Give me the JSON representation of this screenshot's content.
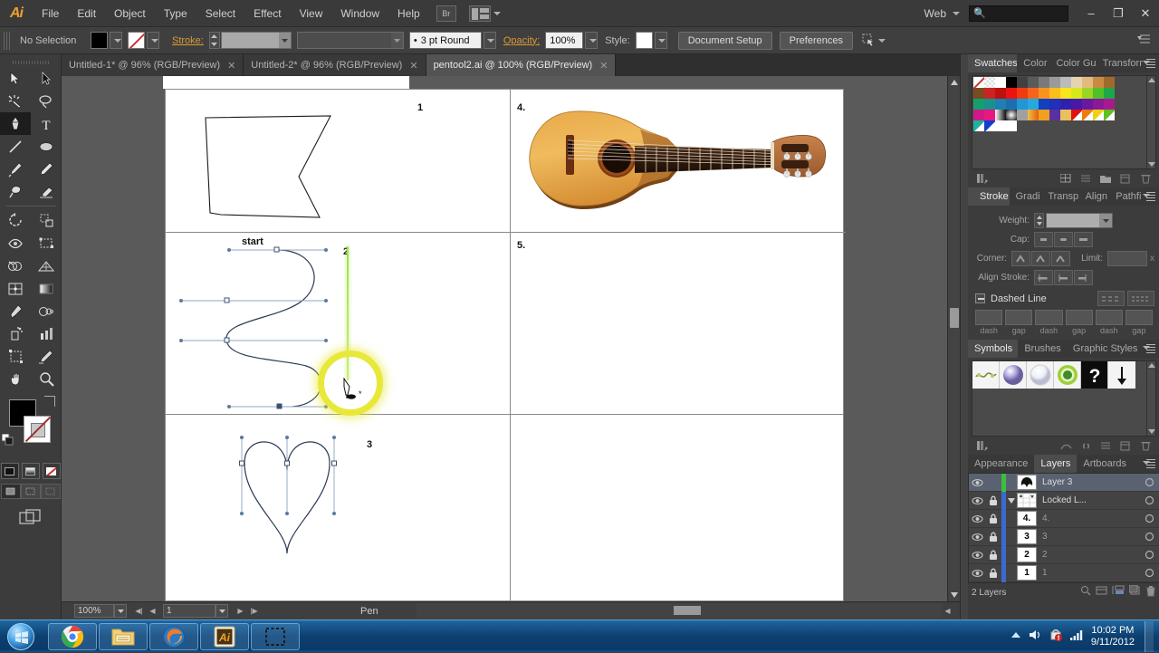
{
  "app": {
    "name": "Adobe Illustrator",
    "logo_text": "Ai"
  },
  "menubar": {
    "items": [
      "File",
      "Edit",
      "Object",
      "Type",
      "Select",
      "Effect",
      "View",
      "Window",
      "Help"
    ],
    "bridge_icon": "bridge-icon",
    "arrange_icon": "arrange-documents-icon",
    "workspace_label": "Web",
    "search_placeholder": "",
    "window_controls": {
      "minimize": "–",
      "restore": "❐",
      "close": "✕"
    }
  },
  "controlbar": {
    "selection_status": "No Selection",
    "fill_color": "#000000",
    "stroke_label": "Stroke:",
    "stroke_weight_value": "",
    "stroke_profile_value": "",
    "brush_value": "3 pt Round",
    "opacity_label": "Opacity:",
    "opacity_value": "100%",
    "style_label": "Style:",
    "document_setup_label": "Document Setup",
    "preferences_label": "Preferences",
    "transform_icon": "transform-icon",
    "panel_menu_icon": "panel-options-icon"
  },
  "tabs": [
    {
      "title": "Untitled-1* @ 96% (RGB/Preview)",
      "active": false,
      "close": "✕"
    },
    {
      "title": "Untitled-2* @ 96% (RGB/Preview)",
      "active": false,
      "close": "✕"
    },
    {
      "title": "pentool2.ai @ 100% (RGB/Preview)",
      "active": true,
      "close": "✕"
    }
  ],
  "toolbar": {
    "tools": [
      {
        "name": "selection-tool",
        "selected": false
      },
      {
        "name": "direct-selection-tool",
        "selected": false
      },
      {
        "name": "magic-wand-tool",
        "selected": false
      },
      {
        "name": "lasso-tool",
        "selected": false
      },
      {
        "name": "pen-tool",
        "selected": true
      },
      {
        "name": "type-tool",
        "selected": false
      },
      {
        "name": "line-segment-tool",
        "selected": false
      },
      {
        "name": "ellipse-tool",
        "selected": false
      },
      {
        "name": "paintbrush-tool",
        "selected": false
      },
      {
        "name": "pencil-tool",
        "selected": false
      },
      {
        "name": "blob-brush-tool",
        "selected": false
      },
      {
        "name": "eraser-tool",
        "selected": false
      },
      {
        "name": "rotate-tool",
        "selected": false
      },
      {
        "name": "scale-tool",
        "selected": false
      },
      {
        "name": "width-tool",
        "selected": false
      },
      {
        "name": "free-transform-tool",
        "selected": false
      },
      {
        "name": "shape-builder-tool",
        "selected": false
      },
      {
        "name": "perspective-grid-tool",
        "selected": false
      },
      {
        "name": "mesh-tool",
        "selected": false
      },
      {
        "name": "gradient-tool",
        "selected": false
      },
      {
        "name": "eyedropper-tool",
        "selected": false
      },
      {
        "name": "blend-tool",
        "selected": false
      },
      {
        "name": "symbol-sprayer-tool",
        "selected": false
      },
      {
        "name": "column-graph-tool",
        "selected": false
      },
      {
        "name": "artboard-tool",
        "selected": false
      },
      {
        "name": "slice-tool",
        "selected": false
      },
      {
        "name": "hand-tool",
        "selected": false
      },
      {
        "name": "zoom-tool",
        "selected": false
      }
    ],
    "fill_color": "#000000",
    "stroke_color": "#ffffff",
    "draw_modes": [
      "draw-normal",
      "draw-behind",
      "draw-inside"
    ],
    "screen_mode": "screen-mode-icon"
  },
  "canvas": {
    "panels": [
      {
        "number": "1",
        "content": "polygon-shape"
      },
      {
        "number": "2",
        "content": "s-curve-path",
        "extra_label": "start"
      },
      {
        "number": "3",
        "content": "heart-shape"
      },
      {
        "number": "4.",
        "content": "guitar-image"
      },
      {
        "number": "5.",
        "content": "empty"
      }
    ],
    "cursor": {
      "tool": "pen-tool-cursor",
      "highlight_color": "#e8e83a",
      "guide_color": "#9ee04a"
    }
  },
  "statusbar": {
    "zoom_value": "100%",
    "page_value": "1",
    "tool_name": "Pen"
  },
  "panels": {
    "group_top": {
      "tabs": [
        "Swatches",
        "Color",
        "Color Gu",
        "Transforr"
      ],
      "active": "Swatches",
      "swatch_rows": [
        [
          "#ffffff",
          "#ffffff",
          "#ffffff",
          "#000000",
          "#404040",
          "#5a5a5a",
          "#7a7a7a",
          "#9a9a9a",
          "#bbbbbb",
          "#e8d3b0",
          "#e2b97f",
          "#c98b43",
          "#a06a2c",
          "#7b4a1e",
          "#cc2222",
          "#bb1111"
        ],
        [
          "#ee1111",
          "#f03a10",
          "#f5641a",
          "#f8941d",
          "#fbbf1c",
          "#fbe51c",
          "#d6e81c",
          "#9ad623",
          "#4fc028",
          "#1ca84a",
          "#14a06a",
          "#15938c",
          "#1f7fb0",
          "#1b6fae",
          "#2098d6",
          "#24a9e0"
        ],
        [
          "#1040c0",
          "#2030b8",
          "#3020b0",
          "#4a18a8",
          "#6a18a0",
          "#8a1898",
          "#aa1890",
          "#d01888",
          "#e81880",
          "#f0f0f0",
          "#303030",
          "#a0a0a0",
          "#e0e0e0",
          "#f0a020",
          "#5a30a0",
          "#e8c060"
        ],
        [
          "#e01010",
          "#f07a10",
          "#f0d010",
          "#60c020",
          "#20b0a0",
          "#1040d0",
          "#ffffff",
          "#ffffff"
        ]
      ],
      "footer_icons": [
        "swatch-libraries-icon",
        "show-swatch-kinds-icon",
        "new-color-group-icon",
        "new-swatch-icon",
        "delete-swatch-icon"
      ]
    },
    "group_stroke": {
      "tabs": [
        "Stroke",
        "Gradi",
        "Transp",
        "Align",
        "Pathfi"
      ],
      "active": "Stroke",
      "weight_label": "Weight:",
      "weight_value": "",
      "cap_label": "Cap:",
      "corner_label": "Corner:",
      "limit_label": "Limit:",
      "limit_value": "",
      "limit_unit": "x",
      "align_stroke_label": "Align Stroke:",
      "dashed_line_label": "Dashed Line",
      "dash_labels": [
        "dash",
        "gap",
        "dash",
        "gap",
        "dash",
        "gap"
      ]
    },
    "group_symbols": {
      "tabs": [
        "Symbols",
        "Brushes",
        "Graphic Styles"
      ],
      "active": "Symbols",
      "symbols": [
        "vine-symbol",
        "purple-sphere-symbol",
        "white-sphere-symbol",
        "green-target-symbol",
        "question-mark-symbol",
        "arrow-down-symbol"
      ],
      "footer_icons": [
        "symbol-libraries-icon",
        "place-symbol-instance-icon",
        "break-link-icon",
        "symbol-options-icon",
        "new-symbol-icon",
        "delete-symbol-icon"
      ]
    },
    "group_layers": {
      "tabs": [
        "Appearance",
        "Layers",
        "Artboards"
      ],
      "active": "Layers",
      "rows": [
        {
          "name": "Layer 3",
          "thumb": "",
          "color": "#3ac03a",
          "locked": false,
          "selected": true,
          "visible": true,
          "expandable": false
        },
        {
          "name": "Locked L...",
          "thumb": "",
          "color": "#3a6ad0",
          "locked": true,
          "selected": false,
          "visible": true,
          "expandable": true
        },
        {
          "name": "4.",
          "thumb": "4.",
          "color": "#3a6ad0",
          "locked": true,
          "selected": false,
          "visible": true,
          "expandable": false
        },
        {
          "name": "3",
          "thumb": "3",
          "color": "#3a6ad0",
          "locked": true,
          "selected": false,
          "visible": true,
          "expandable": false
        },
        {
          "name": "2",
          "thumb": "2",
          "color": "#3a6ad0",
          "locked": true,
          "selected": false,
          "visible": true,
          "expandable": false
        },
        {
          "name": "1",
          "thumb": "1",
          "color": "#3a6ad0",
          "locked": true,
          "selected": false,
          "visible": true,
          "expandable": false
        }
      ],
      "footer_count": "2 Layers",
      "footer_icons": [
        "locate-object-icon",
        "make-clipping-mask-icon",
        "create-new-sublayer-icon",
        "create-new-layer-icon",
        "delete-selection-icon"
      ]
    }
  },
  "taskbar": {
    "start_button": "start-orb",
    "apps": [
      {
        "name": "google-chrome-taskbar-icon"
      },
      {
        "name": "windows-explorer-taskbar-icon"
      },
      {
        "name": "mozilla-firefox-taskbar-icon"
      },
      {
        "name": "adobe-illustrator-taskbar-icon",
        "label": "Ai"
      },
      {
        "name": "snipping-tool-taskbar-icon"
      }
    ],
    "tray": {
      "show_hidden_icons": "chevron-up-icon",
      "volume": "speaker-icon",
      "action_center": "action-center-icon",
      "network": "network-signal-icon",
      "time": "10:02 PM",
      "date": "9/11/2012"
    }
  }
}
